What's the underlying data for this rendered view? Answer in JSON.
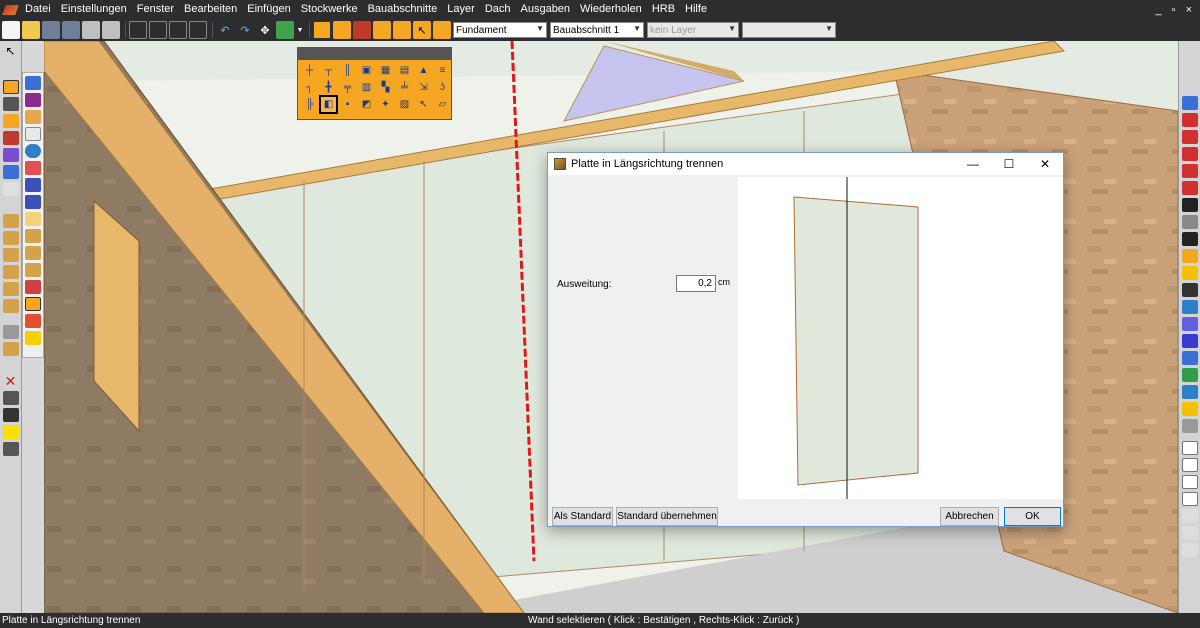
{
  "menubar": {
    "items": [
      "Datei",
      "Einstellungen",
      "Fenster",
      "Bearbeiten",
      "Einfügen",
      "Stockwerke",
      "Bauabschnitte",
      "Layer",
      "Dach",
      "Ausgaben",
      "Wiederholen",
      "HRB",
      "Hilfe"
    ],
    "window_controls": [
      "_",
      "▫",
      "×"
    ]
  },
  "toolbar": {
    "floor_select": "Fundament",
    "section_select": "Bauabschnitt 1",
    "layer_select": "kein Layer",
    "extra_select": ""
  },
  "dialog": {
    "title": "Platte in Längsrichtung trennen",
    "minimize": "—",
    "maximize": "☐",
    "close": "✕",
    "field_label": "Ausweitung:",
    "field_value": "0,2",
    "field_unit": "cm",
    "btn_als_standard": "Als Standard",
    "btn_standard_uebernehmen": "Standard übernehmen",
    "btn_abbrechen": "Abbrechen",
    "btn_ok": "OK"
  },
  "statusbar": {
    "left": "Platte in Längsrichtung trennen",
    "center": "Wand selektieren ( Klick : Bestätigen ,  Rechts-Klick : Zurück )"
  },
  "colors": {
    "palette_bg": "#f5a623",
    "osb": "#c9a27a",
    "timber": "#e8b86a",
    "wall_panel": "#dde8dc",
    "accent_red": "#e21818"
  },
  "icons": {
    "palette": [
      "wall-joint-icon",
      "wall-t-icon",
      "wall-column-icon",
      "wall-select-icon",
      "wall-grid-icon",
      "wall-tool-icon",
      "wall-roof-icon",
      "wall-stack-icon",
      "wall-corner-icon",
      "wall-pipe-icon",
      "wall-split-icon",
      "wall-panel-icon",
      "wall-cut-icon",
      "wall-edge-icon",
      "wall-arrow-icon",
      "wall-hook-icon",
      "wall-bracket-icon",
      "split-panel-icon",
      "wall-small-icon",
      "wall-lift-icon",
      "wall-move-icon",
      "wall-pointer-icon",
      "wall-sheet-icon",
      ""
    ]
  }
}
